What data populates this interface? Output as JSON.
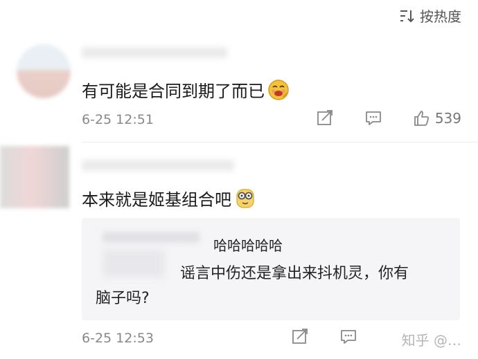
{
  "sort": {
    "label": "按热度",
    "icon": "sort-icon"
  },
  "comments": [
    {
      "text": "有可能是合同到期了而已",
      "emoji": "giggle-emoji",
      "time": "6-25 12:51",
      "likes": "539"
    },
    {
      "text": "本来就是姬基组合吧",
      "emoji": "glasses-emoji",
      "time": "6-25 12:53",
      "reply": {
        "line1": "哈哈哈哈哈",
        "line2": "谣言中伤还是拿出来抖机灵，你有",
        "line3": "脑子吗?"
      },
      "watermark": "知乎 @…"
    }
  ],
  "colors": {
    "text": "#1a1a1a",
    "meta": "#888888",
    "reply_bg": "#f5f5f7",
    "emoji_yellow": "#f3c13a"
  }
}
